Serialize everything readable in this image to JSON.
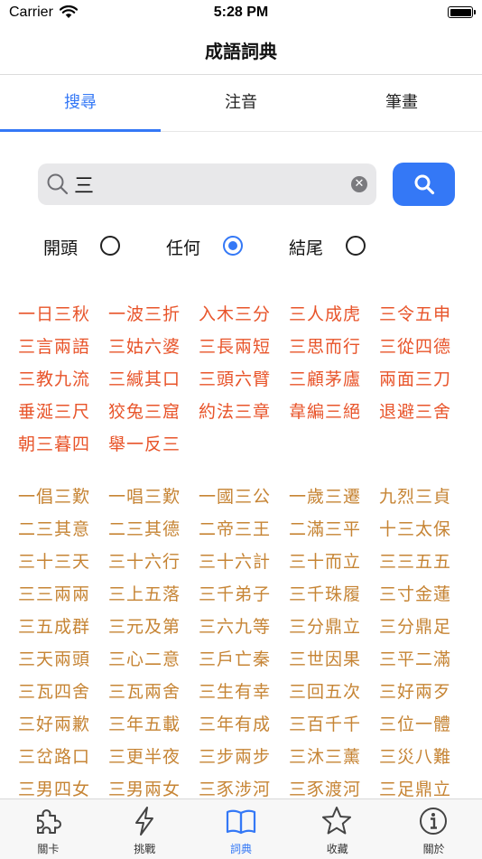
{
  "status_bar": {
    "carrier": "Carrier",
    "time": "5:28 PM",
    "battery_level": 1.0
  },
  "nav": {
    "title": "成語詞典"
  },
  "segments": [
    {
      "label": "搜尋",
      "active": true
    },
    {
      "label": "注音",
      "active": false
    },
    {
      "label": "筆畫",
      "active": false
    }
  ],
  "search": {
    "value": "三",
    "placeholder": ""
  },
  "match_options": [
    {
      "label": "開頭",
      "checked": false
    },
    {
      "label": "任何",
      "checked": true
    },
    {
      "label": "結尾",
      "checked": false
    }
  ],
  "results_exact": [
    "一日三秋",
    "一波三折",
    "入木三分",
    "三人成虎",
    "三令五申",
    "三言兩語",
    "三姑六婆",
    "三長兩短",
    "三思而行",
    "三從四德",
    "三教九流",
    "三緘其口",
    "三頭六臂",
    "三顧茅廬",
    "兩面三刀",
    "垂涎三尺",
    "狡兔三窟",
    "約法三章",
    "韋編三絕",
    "退避三舍",
    "朝三暮四",
    "舉一反三"
  ],
  "results_other": [
    "一倡三歎",
    "一唱三歎",
    "一國三公",
    "一歲三遷",
    "九烈三貞",
    "二三其意",
    "二三其德",
    "二帝三王",
    "二滿三平",
    "十三太保",
    "三十三天",
    "三十六行",
    "三十六計",
    "三十而立",
    "三三五五",
    "三三兩兩",
    "三上五落",
    "三千弟子",
    "三千珠履",
    "三寸金蓮",
    "三五成群",
    "三元及第",
    "三六九等",
    "三分鼎立",
    "三分鼎足",
    "三天兩頭",
    "三心二意",
    "三戶亡秦",
    "三世因果",
    "三平二滿",
    "三瓦四舍",
    "三瓦兩舍",
    "三生有幸",
    "三回五次",
    "三好兩歹",
    "三好兩歉",
    "三年五載",
    "三年有成",
    "三百千千",
    "三位一體",
    "三岔路口",
    "三更半夜",
    "三步兩步",
    "三沐三薰",
    "三災八難",
    "三男四女",
    "三男兩女",
    "三豕涉河",
    "三豕渡河",
    "三足鼎立"
  ],
  "tabs": [
    {
      "label": "關卡",
      "icon": "puzzle-icon",
      "active": false
    },
    {
      "label": "挑戰",
      "icon": "bolt-icon",
      "active": false
    },
    {
      "label": "詞典",
      "icon": "book-icon",
      "active": true
    },
    {
      "label": "收藏",
      "icon": "star-icon",
      "active": false
    },
    {
      "label": "關於",
      "icon": "info-icon",
      "active": false
    }
  ],
  "colors": {
    "accent": "#3478f6",
    "exact_word": "#e8542a",
    "other_word": "#c68434"
  }
}
